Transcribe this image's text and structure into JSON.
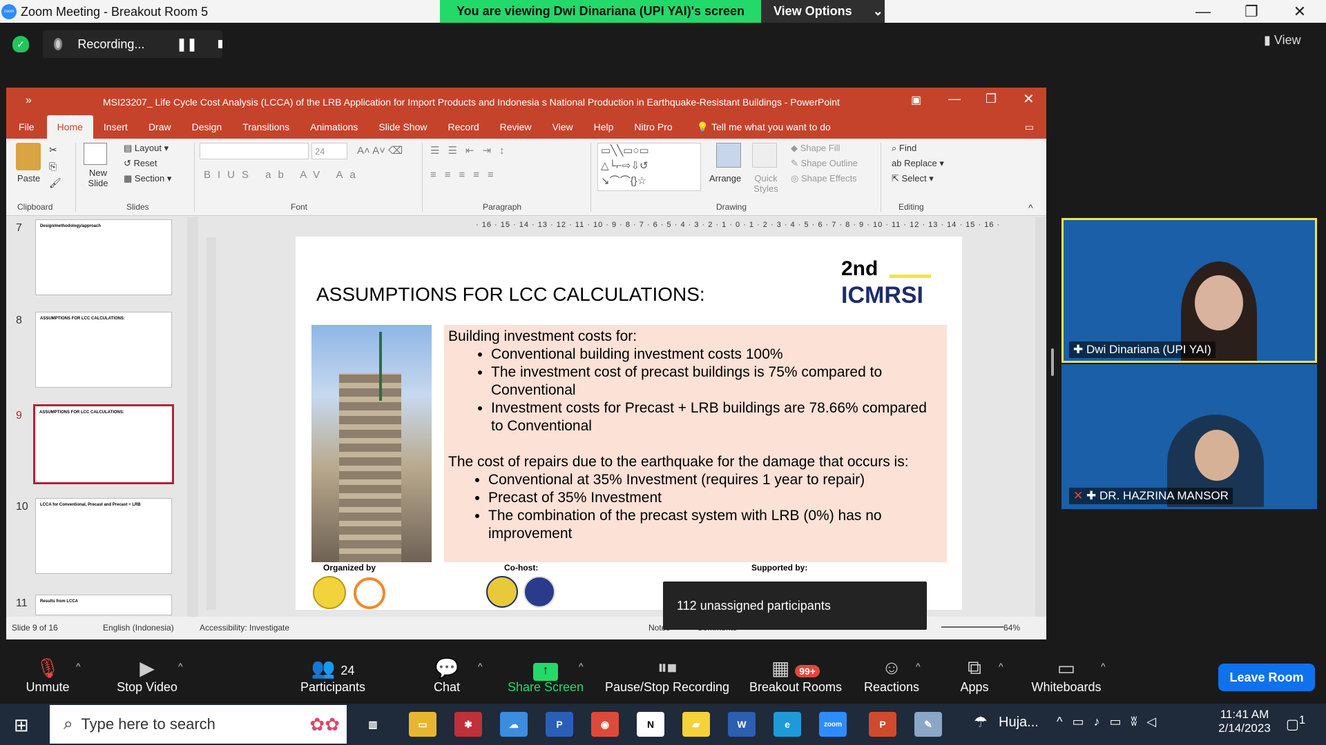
{
  "zoom": {
    "window_title": "Zoom Meeting - Breakout Room 5",
    "logo_text": "zoom",
    "viewing_banner": "You are viewing Dwi Dinariana (UPI YAI)'s screen",
    "view_options": "View Options",
    "recording_label": "Recording...",
    "view_label": "View",
    "participants_count": "24",
    "breakout_badge": "99+",
    "tooltip": "112 unassigned participants",
    "leave_label": "Leave Room",
    "toolbar": [
      {
        "icon": "mic-off-icon",
        "label": "Unmute"
      },
      {
        "icon": "video-icon",
        "label": "Stop Video"
      },
      {
        "icon": "participants-icon",
        "label": "Participants"
      },
      {
        "icon": "chat-icon",
        "label": "Chat"
      },
      {
        "icon": "share-screen-icon",
        "label": "Share Screen"
      },
      {
        "icon": "pause-stop-icon",
        "label": "Pause/Stop Recording"
      },
      {
        "icon": "breakout-icon",
        "label": "Breakout Rooms"
      },
      {
        "icon": "reactions-icon",
        "label": "Reactions"
      },
      {
        "icon": "apps-icon",
        "label": "Apps"
      },
      {
        "icon": "whiteboard-icon",
        "label": "Whiteboards"
      }
    ],
    "gallery": [
      {
        "name": "Dwi Dinariana (UPI YAI)"
      },
      {
        "name": "DR. HAZRINA MANSOR"
      }
    ]
  },
  "ppt": {
    "title": "MSI23207_ Life Cycle Cost Analysis (LCCA) of the LRB Application for Import Products and Indonesia s National Production in Earthquake-Resistant Buildings  -  PowerPoint",
    "tabs": [
      "File",
      "Home",
      "Insert",
      "Draw",
      "Design",
      "Transitions",
      "Animations",
      "Slide Show",
      "Record",
      "Review",
      "View",
      "Help",
      "Nitro Pro"
    ],
    "tell_me": "Tell me what you want to do",
    "ribbon": {
      "paste": "Paste",
      "clipboard": "Clipboard",
      "new_slide": "New Slide",
      "layout": "Layout",
      "reset": "Reset",
      "section": "Section",
      "slides": "Slides",
      "font_size": "24",
      "font": "Font",
      "paragraph": "Paragraph",
      "arrange": "Arrange",
      "quick_styles": "Quick Styles",
      "shape_fill": "Shape Fill",
      "shape_outline": "Shape Outline",
      "shape_effects": "Shape Effects",
      "drawing": "Drawing",
      "find": "Find",
      "replace": "Replace",
      "select": "Select",
      "editing": "Editing"
    },
    "ruler": "· 16 · 15 · 14 · 13 · 12 · 11 · 10 · 9 · 8 · 7 · 6 · 5 · 4 · 3 · 2 · 1 · 0 · 1 · 2 · 3 · 4 · 5 · 6 · 7 · 8 · 9 · 10 · 11 · 12 · 13 · 14 · 15 · 16 ·",
    "thumbs": [
      {
        "num": "7",
        "title": "Design/methodology/approach"
      },
      {
        "num": "8",
        "title": "ASSUMPTIONS FOR LCC CALCULATIONS:"
      },
      {
        "num": "9",
        "title": "ASSUMPTIONS FOR LCC CALCULATIONS:"
      },
      {
        "num": "10",
        "title": "LCCA for Conventional, Precast and Precast + LRB"
      },
      {
        "num": "11",
        "title": "Results from LCCA"
      }
    ],
    "slide": {
      "heading": "ASSUMPTIONS FOR LCC CALCULATIONS:",
      "logo_top": "2nd",
      "logo_bottom": "ICMRSI",
      "para1": "Building investment costs for:",
      "bullets1": [
        "Conventional building investment costs 100%",
        "The investment cost of precast buildings is 75% compared to Conventional",
        "Investment costs for Precast + LRB buildings are 78.66% compared to Conventional"
      ],
      "para2": "The cost of repairs due to the earthquake for the damage that occurs is:",
      "bullets2": [
        "Conventional at 35% Investment (requires 1 year to repair)",
        "Precast of 35% Investment",
        "The combination of the precast system with LRB (0%) has no improvement"
      ],
      "organized_by": "Organized by",
      "co_host": "Co-host:",
      "supported_by": "Supported by:"
    },
    "status": {
      "slide_of": "Slide 9 of 16",
      "language": "English (Indonesia)",
      "accessibility": "Accessibility: Investigate",
      "notes": "Notes",
      "comments": "Comments",
      "zoom": "64%"
    }
  },
  "taskbar": {
    "search_placeholder": "Type here to search",
    "weather": "Huja...",
    "time": "11:41 AM",
    "date": "2/14/2023",
    "notif": "1"
  }
}
